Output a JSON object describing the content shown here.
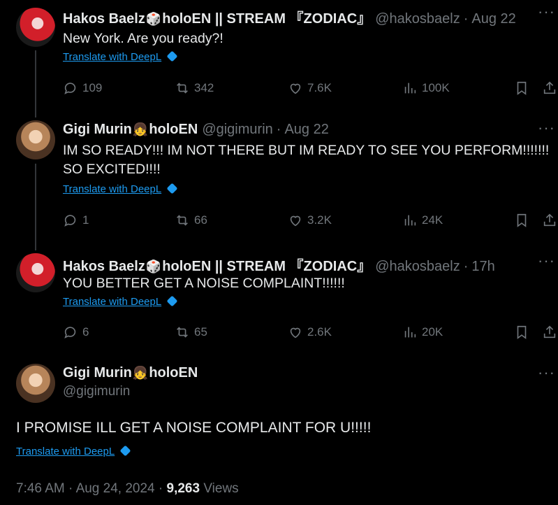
{
  "tweets": [
    {
      "name": "Hakos Baelz",
      "emoji": "🎲",
      "name_suffix": "holoEN || STREAM 『ZODIAC』",
      "handle": "@hakosbaelz",
      "time": "Aug 22",
      "text": "New York. Are you ready?!",
      "translate": "Translate with DeepL",
      "replies": "109",
      "retweets": "342",
      "likes": "7.6K",
      "views": "100K"
    },
    {
      "name": "Gigi Murin",
      "emoji": "👧",
      "name_suffix": "holoEN",
      "handle": "@gigimurin",
      "time": "Aug 22",
      "text": "IM SO READY!!! IM NOT THERE BUT IM READY TO SEE YOU PERFORM!!!!!!! SO EXCITED!!!!",
      "translate": "Translate with DeepL",
      "replies": "1",
      "retweets": "66",
      "likes": "3.2K",
      "views": "24K"
    },
    {
      "name": "Hakos Baelz",
      "emoji": "🎲",
      "name_suffix": "holoEN || STREAM 『ZODIAC』",
      "handle": "@hakosbaelz",
      "time": "17h",
      "text": "YOU BETTER GET A NOISE COMPLAINT!!!!!!",
      "translate": "Translate with DeepL",
      "replies": "6",
      "retweets": "65",
      "likes": "2.6K",
      "views": "20K"
    }
  ],
  "main": {
    "name": "Gigi Murin",
    "emoji": "👧",
    "name_suffix": "holoEN",
    "handle": "@gigimurin",
    "text": "I PROMISE ILL GET A NOISE COMPLAINT FOR U!!!!!",
    "translate": "Translate with DeepL",
    "time": "7:46 AM",
    "date": "Aug 24, 2024",
    "views_count": "9,263",
    "views_label": "Views"
  },
  "colors": {
    "background": "#000000",
    "text": "#e7e9ea",
    "muted": "#71767b",
    "link": "#1d9bf0"
  }
}
